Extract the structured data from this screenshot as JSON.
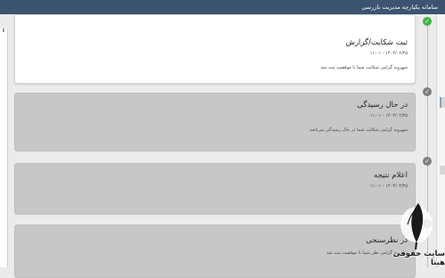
{
  "header": {
    "title": "سامانه یکپارچه مدیریت بازرسی"
  },
  "timeline": {
    "items": [
      {
        "title": "ثبت شکایت/گزارش",
        "date": "۱۴۰۴/۰۲/۲۵ - ۱۱:۰۱",
        "message": "شهروند گرامی شکایت شما با موفقیت ثبت شد",
        "status": "done"
      },
      {
        "title": "در حال رسیدگی",
        "date": "۱۴۰۴/۰۲/۲۵ - ۱۱:۰۱",
        "message": "شهروند گرامی شکایت شما در حال رسیدگی می‌باشد",
        "status": "pending"
      },
      {
        "title": "اعلام نتیجه",
        "date": "۱۴۰۴/۰۲/۲۵ - ۱۱:۰۱",
        "message": "",
        "status": "pending"
      },
      {
        "title": "در نظرسنجی",
        "date": "",
        "message": "شهروند گرامی نظر شما با موفقیت ثبت شد",
        "status": "pending"
      }
    ]
  },
  "watermark": {
    "text": "سایت حقوقی هینا"
  },
  "colors": {
    "header_bg": "#3b5470",
    "done_green": "#3fb24a",
    "pending_gray": "#7d7d7d",
    "inactive_card": "#c7c7c7"
  },
  "icons": {
    "done": "check-icon",
    "pending": "check-icon"
  }
}
